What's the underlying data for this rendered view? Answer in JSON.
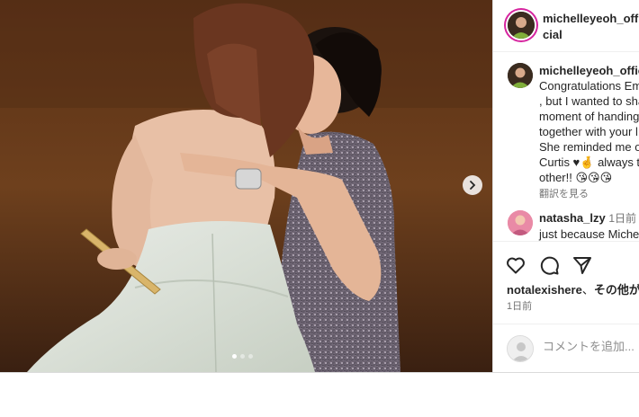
{
  "post": {
    "author": "michelleyeoh_official",
    "author_line1": "michelleyeoh_offi",
    "author_line2": "cial",
    "caption_handle": "michelleyeoh_offici",
    "caption_lines": [
      "Congratulations Em",
      ", but I wanted to sha",
      "moment of handing",
      "together with your l",
      "She reminded me o",
      "Curtis ♥🤞 always t",
      "other!! 😘😘😘"
    ],
    "translate_label": "翻訳を見る"
  },
  "comment": {
    "username": "natasha_lzy",
    "time": "1日前",
    "text": "just because Michel"
  },
  "likes": {
    "user": "notalexishere",
    "separator": "、",
    "suffix": "その他が"
  },
  "date": "1日前",
  "add_comment": {
    "placeholder": "コメントを追加..."
  },
  "carousel": {
    "total": 3,
    "active_index": 0
  },
  "icons": {
    "next": "chevron-right-icon",
    "like": "heart-icon",
    "comment": "comment-bubble-icon",
    "share": "paper-plane-icon"
  },
  "colors": {
    "story_ring": "#d6249f",
    "text": "#262626",
    "muted": "#737373"
  }
}
